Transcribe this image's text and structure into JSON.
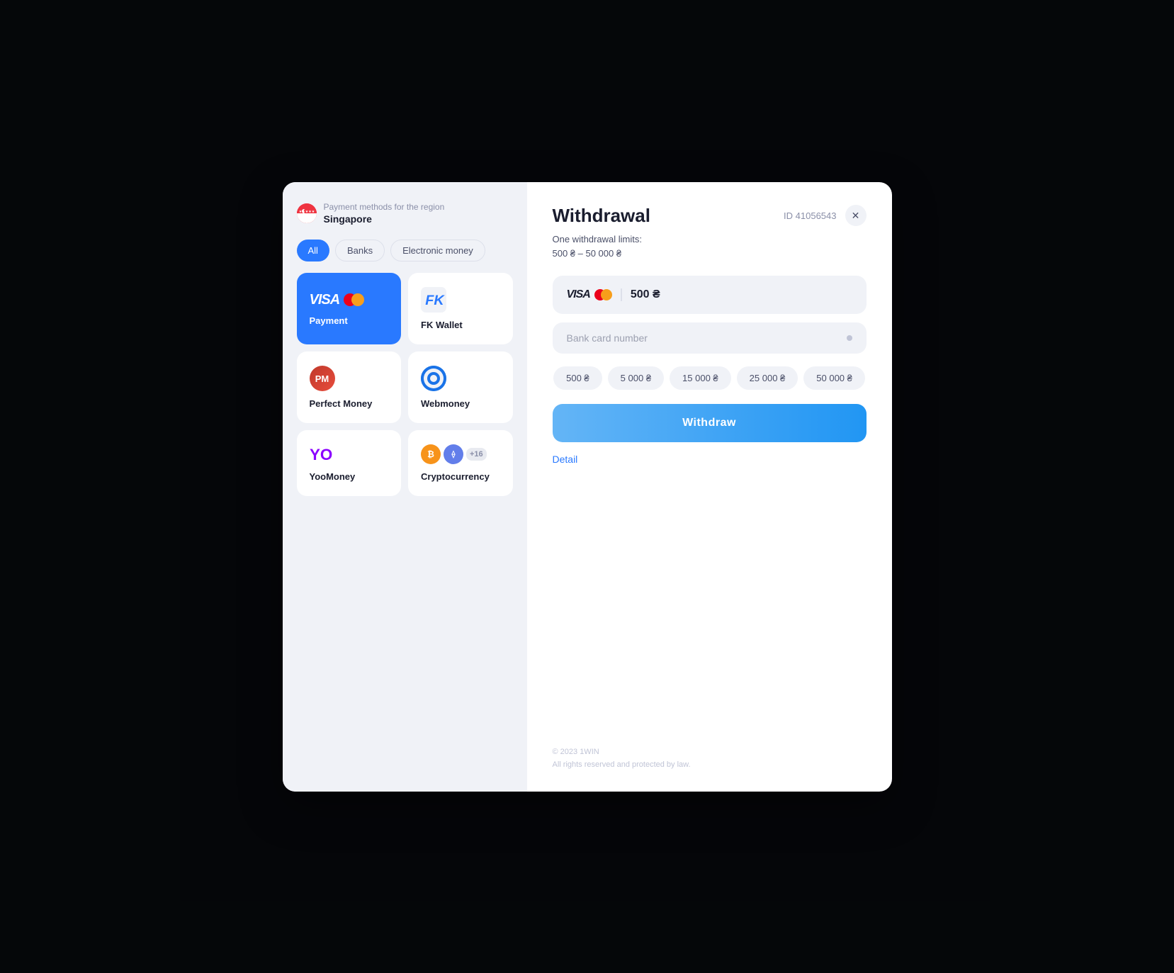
{
  "modal": {
    "region_label": "Payment methods for the region",
    "region_name": "Singapore",
    "filters": [
      {
        "id": "all",
        "label": "All",
        "active": true
      },
      {
        "id": "banks",
        "label": "Banks",
        "active": false
      },
      {
        "id": "electronic",
        "label": "Electronic money",
        "active": false
      }
    ],
    "payment_methods": [
      {
        "id": "visa",
        "label": "Payment",
        "type": "visa",
        "selected": true
      },
      {
        "id": "fk_wallet",
        "label": "FK Wallet",
        "type": "fk",
        "selected": false
      },
      {
        "id": "perfect_money",
        "label": "Perfect Money",
        "type": "pm",
        "selected": false
      },
      {
        "id": "webmoney",
        "label": "Webmoney",
        "type": "wm",
        "selected": false
      },
      {
        "id": "yoomoney",
        "label": "YooMoney",
        "type": "yoo",
        "selected": false
      },
      {
        "id": "cryptocurrency",
        "label": "Cryptocurrency",
        "type": "crypto",
        "selected": false
      }
    ]
  },
  "withdrawal": {
    "title": "Withdrawal",
    "id_label": "ID 41056543",
    "limits_line1": "One withdrawal limits:",
    "limits_line2": "500 ₴ – 50 000 ₴",
    "amount_value": "500 ₴",
    "card_placeholder": "Bank card number",
    "quick_amounts": [
      "500 ₴",
      "5 000 ₴",
      "15 000 ₴",
      "25 000 ₴",
      "50 000 ₴"
    ],
    "withdraw_btn": "Withdraw",
    "detail_link": "Detail"
  },
  "footer": {
    "line1": "© 2023 1WIN",
    "line2": "All rights reserved and protected by law."
  },
  "icons": {
    "close": "✕",
    "btc": "₿",
    "eth": "⟠"
  }
}
